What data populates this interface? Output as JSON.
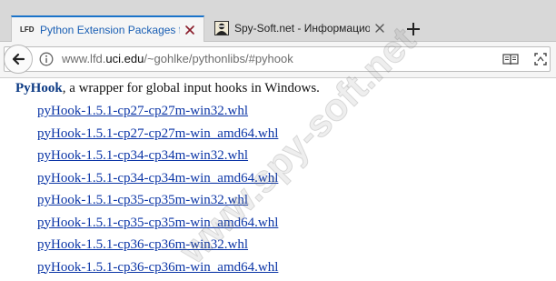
{
  "tabs": [
    {
      "favicon": "LFD",
      "title": "Python Extension Packages f",
      "active": true
    },
    {
      "favicon": "spy-soft-icon",
      "title": "Spy-Soft.net - Информацион",
      "active": false
    }
  ],
  "navbar": {
    "url_prefix": "www.lfd.",
    "url_host": "uci.edu",
    "url_rest": "/~gohlke/pythonlibs/#pyhook"
  },
  "content": {
    "package_name": "PyHook",
    "description": ", a wrapper for global input hooks in Windows.",
    "files": [
      "pyHook-1.5.1-cp27-cp27m-win32.whl",
      "pyHook-1.5.1-cp27-cp27m-win_amd64.whl",
      "pyHook-1.5.1-cp34-cp34m-win32.whl",
      "pyHook-1.5.1-cp34-cp34m-win_amd64.whl",
      "pyHook-1.5.1-cp35-cp35m-win32.whl",
      "pyHook-1.5.1-cp35-cp35m-win_amd64.whl",
      "pyHook-1.5.1-cp36-cp36m-win32.whl",
      "pyHook-1.5.1-cp36-cp36m-win_amd64.whl"
    ]
  },
  "watermark": "www.spy-soft.net",
  "colors": {
    "tab_accent": "#1a73c9",
    "link": "#0b35a6",
    "package_name": "#0c3a84"
  }
}
